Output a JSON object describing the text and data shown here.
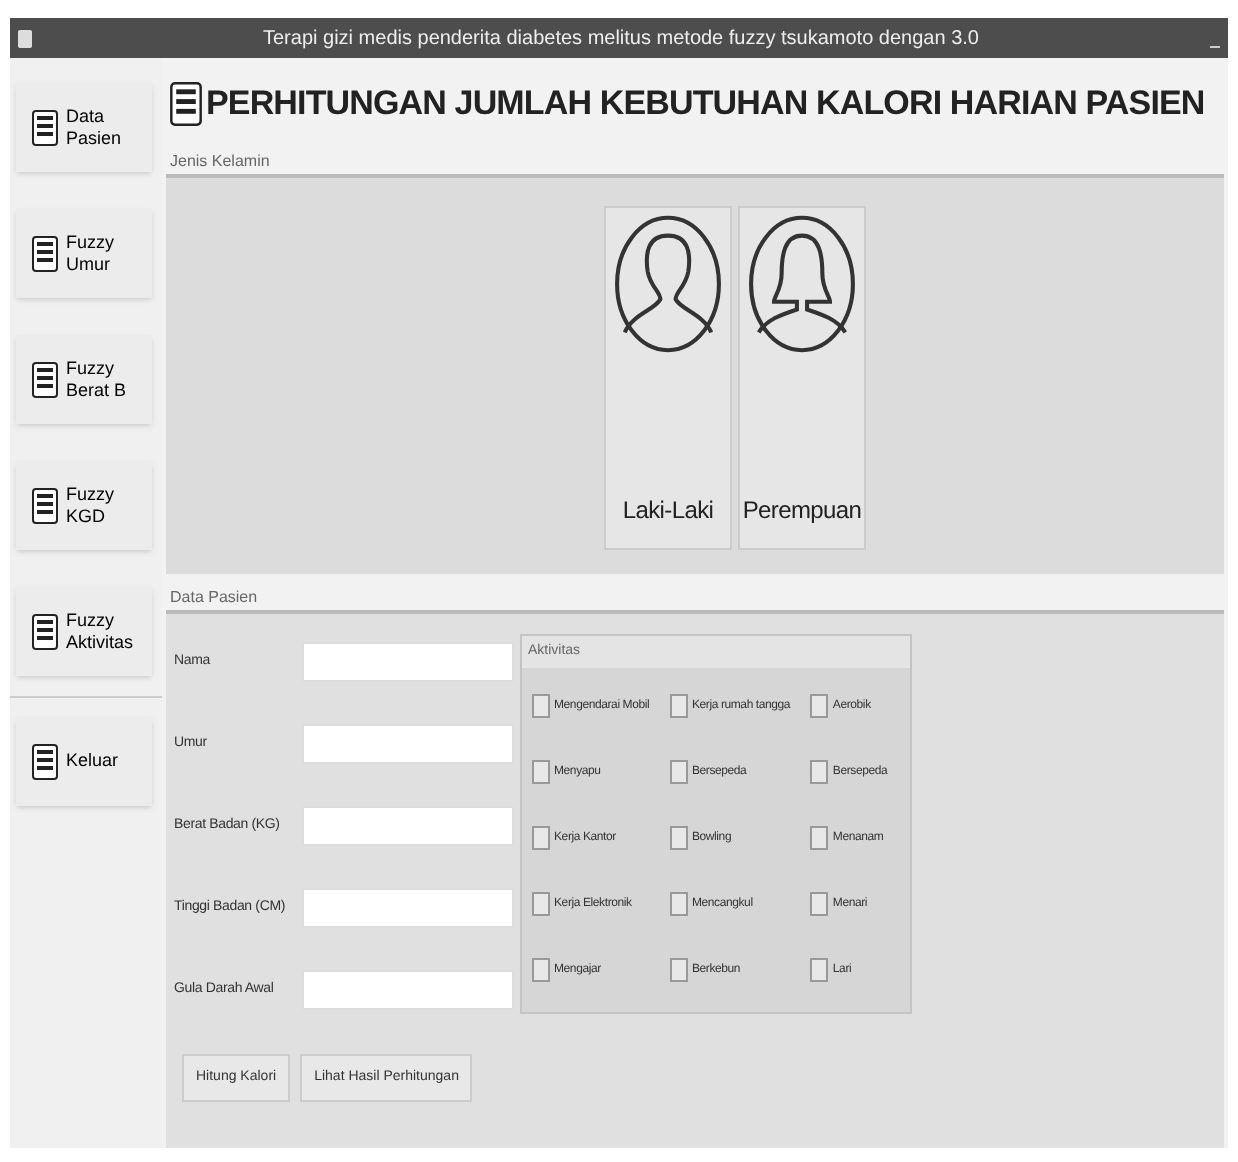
{
  "window": {
    "title": "Terapi gizi medis penderita diabetes melitus metode fuzzy tsukamoto dengan 3.0"
  },
  "sidebar": {
    "items": [
      {
        "label": "Data Pasien"
      },
      {
        "label": "Fuzzy Umur"
      },
      {
        "label": "Fuzzy Berat B"
      },
      {
        "label": "Fuzzy KGD"
      },
      {
        "label": "Fuzzy Aktivitas"
      }
    ],
    "bottom_items": [
      {
        "label": "Keluar"
      }
    ]
  },
  "header": {
    "title": "PERHITUNGAN JUMLAH KEBUTUHAN KALORI HARIAN PASIEN"
  },
  "gender": {
    "label": "Jenis Kelamin",
    "options": [
      {
        "label": "Laki-Laki",
        "kind": "male"
      },
      {
        "label": "Perempuan",
        "kind": "female"
      }
    ]
  },
  "patient": {
    "label": "Data Pasien",
    "fields": [
      {
        "label": "Nama"
      },
      {
        "label": "Umur"
      },
      {
        "label": "Berat Badan (KG)"
      },
      {
        "label": "Tinggi Badan (CM)"
      },
      {
        "label": "Gula Darah Awal"
      }
    ],
    "activity": {
      "label": "Aktivitas",
      "options": [
        {
          "label": "Mengendarai Mobil",
          "checked": false
        },
        {
          "label": "Kerja rumah tangga",
          "checked": false
        },
        {
          "label": "Aerobik",
          "checked": false
        },
        {
          "label": "Menyapu",
          "checked": false
        },
        {
          "label": "Bersepeda",
          "checked": false
        },
        {
          "label": "Bersepeda",
          "checked": false
        },
        {
          "label": "Kerja Kantor",
          "checked": false
        },
        {
          "label": "Bowling",
          "checked": false
        },
        {
          "label": "Menanam",
          "checked": false
        },
        {
          "label": "Kerja Elektronik",
          "checked": false
        },
        {
          "label": "Mencangkul",
          "checked": false
        },
        {
          "label": "Menari",
          "checked": false
        },
        {
          "label": "Mengajar",
          "checked": false
        },
        {
          "label": "Berkebun",
          "checked": false
        },
        {
          "label": "Lari",
          "checked": false
        }
      ]
    },
    "buttons": [
      "Hitung Kalori",
      "Lihat Hasil Perhitungan"
    ]
  }
}
